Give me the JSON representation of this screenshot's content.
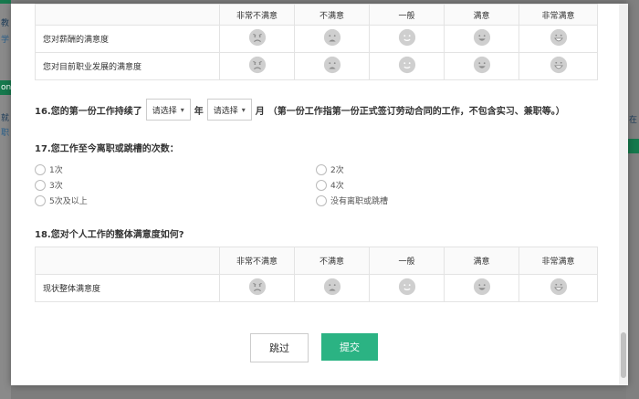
{
  "background": {
    "frag1": "教",
    "frag2": "学",
    "frag3": "on",
    "frag4": "就",
    "frag5": "职",
    "frag_right": "在"
  },
  "scale_headers": [
    "非常不满意",
    "不满意",
    "一般",
    "满意",
    "非常满意"
  ],
  "table1": {
    "rows": [
      {
        "label": "您对薪酬的满意度"
      },
      {
        "label": "您对目前职业发展的满意度"
      }
    ]
  },
  "q16": {
    "prefix": "16.您的第一份工作持续了",
    "select_year_placeholder": "请选择",
    "year_unit": "年",
    "select_month_placeholder": "请选择",
    "month_unit": "月",
    "note": "（第一份工作指第一份正式签订劳动合同的工作，不包含实习、兼职等。）"
  },
  "q17": {
    "title": "17.您工作至今离职或跳槽的次数：",
    "options": [
      "1次",
      "2次",
      "3次",
      "4次",
      "5次及以上",
      "没有离职或跳槽"
    ]
  },
  "q18": {
    "title": "18.您对个人工作的整体满意度如何?",
    "rows": [
      {
        "label": "现状整体满意度"
      }
    ]
  },
  "buttons": {
    "skip": "跳过",
    "submit": "提交"
  },
  "colors": {
    "primary": "#2bb383",
    "face_fill": "#cfcfcf"
  },
  "icons": [
    "very-dissatisfied-face-icon",
    "dissatisfied-face-icon",
    "neutral-face-icon",
    "satisfied-face-icon",
    "very-satisfied-face-icon"
  ]
}
